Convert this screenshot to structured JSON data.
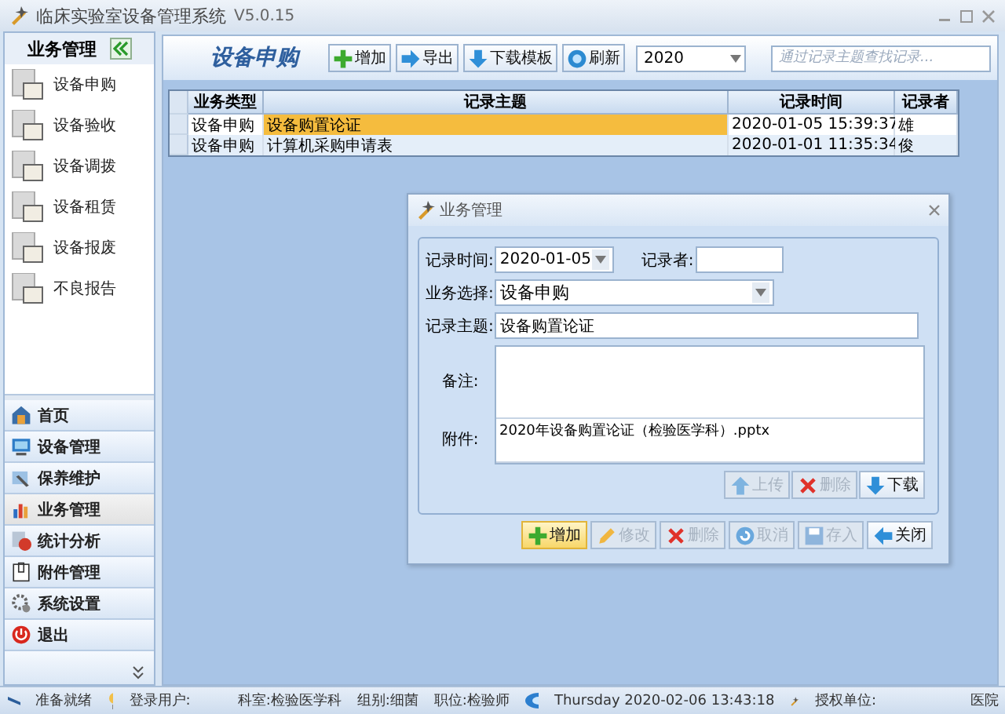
{
  "window": {
    "title": "临床实验室设备管理系统",
    "version": "V5.0.15"
  },
  "sidebar": {
    "title": "业务管理",
    "items": [
      {
        "label": "设备申购"
      },
      {
        "label": "设备验收"
      },
      {
        "label": "设备调拨"
      },
      {
        "label": "设备租赁"
      },
      {
        "label": "设备报废"
      },
      {
        "label": "不良报告"
      }
    ],
    "nav": [
      {
        "label": "首页",
        "selected": false
      },
      {
        "label": "设备管理",
        "selected": false
      },
      {
        "label": "保养维护",
        "selected": false
      },
      {
        "label": "业务管理",
        "selected": true
      },
      {
        "label": "统计分析",
        "selected": false
      },
      {
        "label": "附件管理",
        "selected": false
      },
      {
        "label": "系统设置",
        "selected": false
      },
      {
        "label": "退出",
        "selected": false
      }
    ]
  },
  "module": {
    "title": "设备申购",
    "toolbar": [
      {
        "label": "增加"
      },
      {
        "label": "导出"
      },
      {
        "label": "下载模板"
      },
      {
        "label": "刷新"
      }
    ],
    "year": "2020",
    "search": {
      "placeholder": "通过记录主题查找记录..."
    }
  },
  "table": {
    "columns": [
      "业务类型",
      "记录主题",
      "记录时间",
      "记录者"
    ],
    "rows": [
      {
        "cells": [
          "设备申购",
          "设备购置论证",
          "2020-01-05 15:39:37",
          "雄"
        ],
        "selected": true
      },
      {
        "cells": [
          "设备申购",
          "计算机采购申请表",
          "2020-01-01 11:35:34",
          "俊"
        ],
        "selected": false
      }
    ]
  },
  "dialog": {
    "title": "业务管理",
    "time_label": "记录时间:",
    "time_value": "2020-01-05",
    "recorder_label": "记录者:",
    "type_label": "业务选择:",
    "type_value": "设备申购",
    "subject_label": "记录主题:",
    "subject_value": "设备购置论证",
    "remarks_label": "备注:",
    "attachment_label": "附件:",
    "attachment_value": "2020年设备购置论证（检验医学科）.pptx",
    "file_buttons": [
      {
        "label": "上传",
        "disabled": true
      },
      {
        "label": "删除",
        "disabled": true
      },
      {
        "label": "下载",
        "disabled": false
      }
    ],
    "actions": [
      {
        "label": "增加",
        "disabled": false,
        "selected": true
      },
      {
        "label": "修改",
        "disabled": true,
        "selected": false
      },
      {
        "label": "删除",
        "disabled": true,
        "selected": false
      },
      {
        "label": "取消",
        "disabled": true,
        "selected": false
      },
      {
        "label": "存入",
        "disabled": true,
        "selected": false
      },
      {
        "label": "关闭",
        "disabled": false,
        "selected": false
      }
    ]
  },
  "status_bar": {
    "ready": "准备就绪",
    "user": "登录用户:",
    "department": "科室:检验医学科",
    "group": "组别:细菌",
    "position": "职位:检验师",
    "datetime": "Thursday 2020-02-06 13:43:18",
    "unit_label": "授权单位:",
    "unit_value": "医院"
  }
}
